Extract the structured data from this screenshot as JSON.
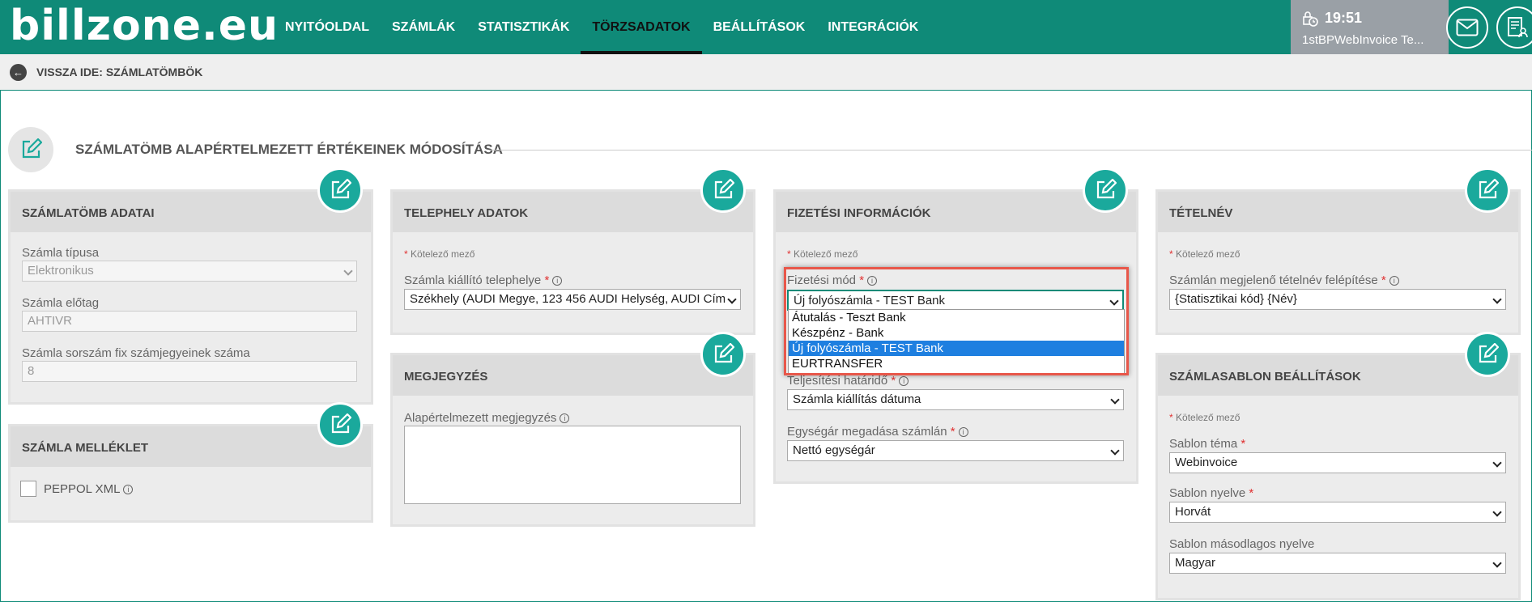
{
  "header": {
    "logo": "billzone.eu",
    "nav": [
      "NYITÓOLDAL",
      "SZÁMLÁK",
      "STATISZTIKÁK",
      "TÖRZSADATOK",
      "BEÁLLÍTÁSOK",
      "INTEGRÁCIÓK"
    ],
    "active_nav": "TÖRZSADATOK",
    "time": "19:51",
    "user": "1stBPWebInvoice Te..."
  },
  "subbar": {
    "back_label": "VISSZA IDE: SZÁMLATÖMBÖK"
  },
  "page_title": "SZÁMLATÖMB ALAPÉRTELMEZETT ÉRTÉKEINEK MÓDOSÍTÁSA",
  "panels": {
    "szamlatomb": {
      "title": "SZÁMLATÖMB ADATAI",
      "type_label": "Számla típusa",
      "type_value": "Elektronikus",
      "prefix_label": "Számla előtag",
      "prefix_value": "AHTIVR",
      "digits_label": "Számla sorszám fix számjegyeinek száma",
      "digits_value": "8"
    },
    "melleklet": {
      "title": "SZÁMLA MELLÉKLET",
      "peppol_label": "PEPPOL XML"
    },
    "telephely": {
      "title": "TELEPHELY ADATOK",
      "required_note": "Kötelező mező",
      "site_label": "Számla kiállító telephelye",
      "site_value": "Székhely (AUDI Megye, 123 456 AUDI Helység, AUDI Cím"
    },
    "megjegyzes": {
      "title": "MEGJEGYZÉS",
      "note_label": "Alapértelmezett megjegyzés"
    },
    "fizetesi": {
      "title": "FIZETÉSI INFORMÁCIÓK",
      "required_note": "Kötelező mező",
      "method_label": "Fizetési mód",
      "method_value": "Új folyószámla - TEST Bank",
      "method_options": [
        "Átutalás - Teszt Bank",
        "Készpénz - Bank",
        "Új folyószámla - TEST Bank",
        "EURTRANSFER"
      ],
      "selected_option": "Új folyószámla - TEST Bank",
      "deadline_label": "Teljesítési határidő",
      "deadline_value": "Számla kiállítás dátuma",
      "unit_label": "Egységár megadása számlán",
      "unit_value": "Nettó egységár"
    },
    "tetelnev": {
      "title": "TÉTELNÉV",
      "required_note": "Kötelező mező",
      "item_label": "Számlán megjelenő tételnév felépítése",
      "item_value": "{Statisztikai kód} {Név}"
    },
    "sablon": {
      "title": "SZÁMLASABLON BEÁLLÍTÁSOK",
      "required_note": "Kötelező mező",
      "theme_label": "Sablon téma",
      "theme_value": "Webinvoice",
      "lang_label": "Sablon nyelve",
      "lang_value": "Horvát",
      "lang2_label": "Sablon másodlagos nyelve",
      "lang2_value": "Magyar"
    }
  },
  "colors": {
    "brand": "#0f8a78",
    "accent": "#1aa99c",
    "highlight": "#e8574a"
  }
}
